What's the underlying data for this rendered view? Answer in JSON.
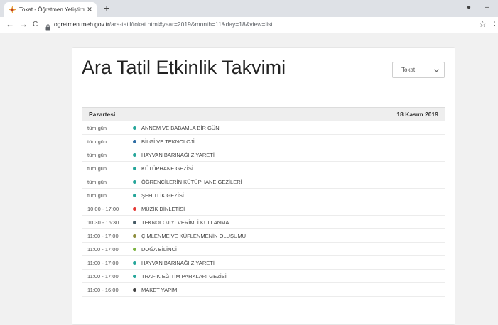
{
  "browser": {
    "tab_title": "Tokat - Öğretmen Yetiştirme ve G",
    "tab_close": "✕",
    "new_tab": "+",
    "back": "←",
    "forward": "→",
    "reload": "C",
    "url_host": "ogretmen.meb.gov.tr",
    "url_path": "/ara-tatil/tokat.html#year=2019&month=11&day=18&view=list",
    "bookmark": "☆"
  },
  "page": {
    "title": "Ara Tatil Etkinlik Takvimi",
    "city_select": "Tokat"
  },
  "calendar": {
    "day_name": "Pazartesi",
    "date": "18 Kasım 2019",
    "events": [
      {
        "time": "tüm gün",
        "name": "ANNEM VE BABAMLA BİR GÜN",
        "color": "#26a69a"
      },
      {
        "time": "tüm gün",
        "name": "BİLGİ VE TEKNOLOJİ",
        "color": "#2e6da4"
      },
      {
        "time": "tüm gün",
        "name": "HAYVAN BARINAĞI ZİYARETİ",
        "color": "#26a69a"
      },
      {
        "time": "tüm gün",
        "name": "KÜTÜPHANE GEZİSİ",
        "color": "#26a69a"
      },
      {
        "time": "tüm gün",
        "name": "ÖĞRENCİLERİN KÜTÜPHANE GEZİLERİ",
        "color": "#26a69a"
      },
      {
        "time": "tüm gün",
        "name": "ŞEHİTLİK GEZİSİ",
        "color": "#26a69a"
      },
      {
        "time": "10:00 - 17:00",
        "name": "MÜZİK DİNLETİSİ",
        "color": "#e53935"
      },
      {
        "time": "10:30 - 16:30",
        "name": "TEKNOLOJİYİ VERİMLİ KULLANMA",
        "color": "#455a64"
      },
      {
        "time": "11:00 - 17:00",
        "name": "ÇİMLENME VE KÜFLENMENİN OLUŞUMU",
        "color": "#8d8d3c"
      },
      {
        "time": "11:00 - 17:00",
        "name": "DOĞA BİLİNCİ",
        "color": "#7cb342"
      },
      {
        "time": "11:00 - 17:00",
        "name": "HAYVAN BARINAĞI ZİYARETİ",
        "color": "#26a69a"
      },
      {
        "time": "11:00 - 17:00",
        "name": "TRAFİK EĞİTİM PARKLARI GEZİSİ",
        "color": "#26a69a"
      },
      {
        "time": "11:00 - 16:00",
        "name": "MAKET YAPIMI",
        "color": "#424242"
      }
    ]
  }
}
